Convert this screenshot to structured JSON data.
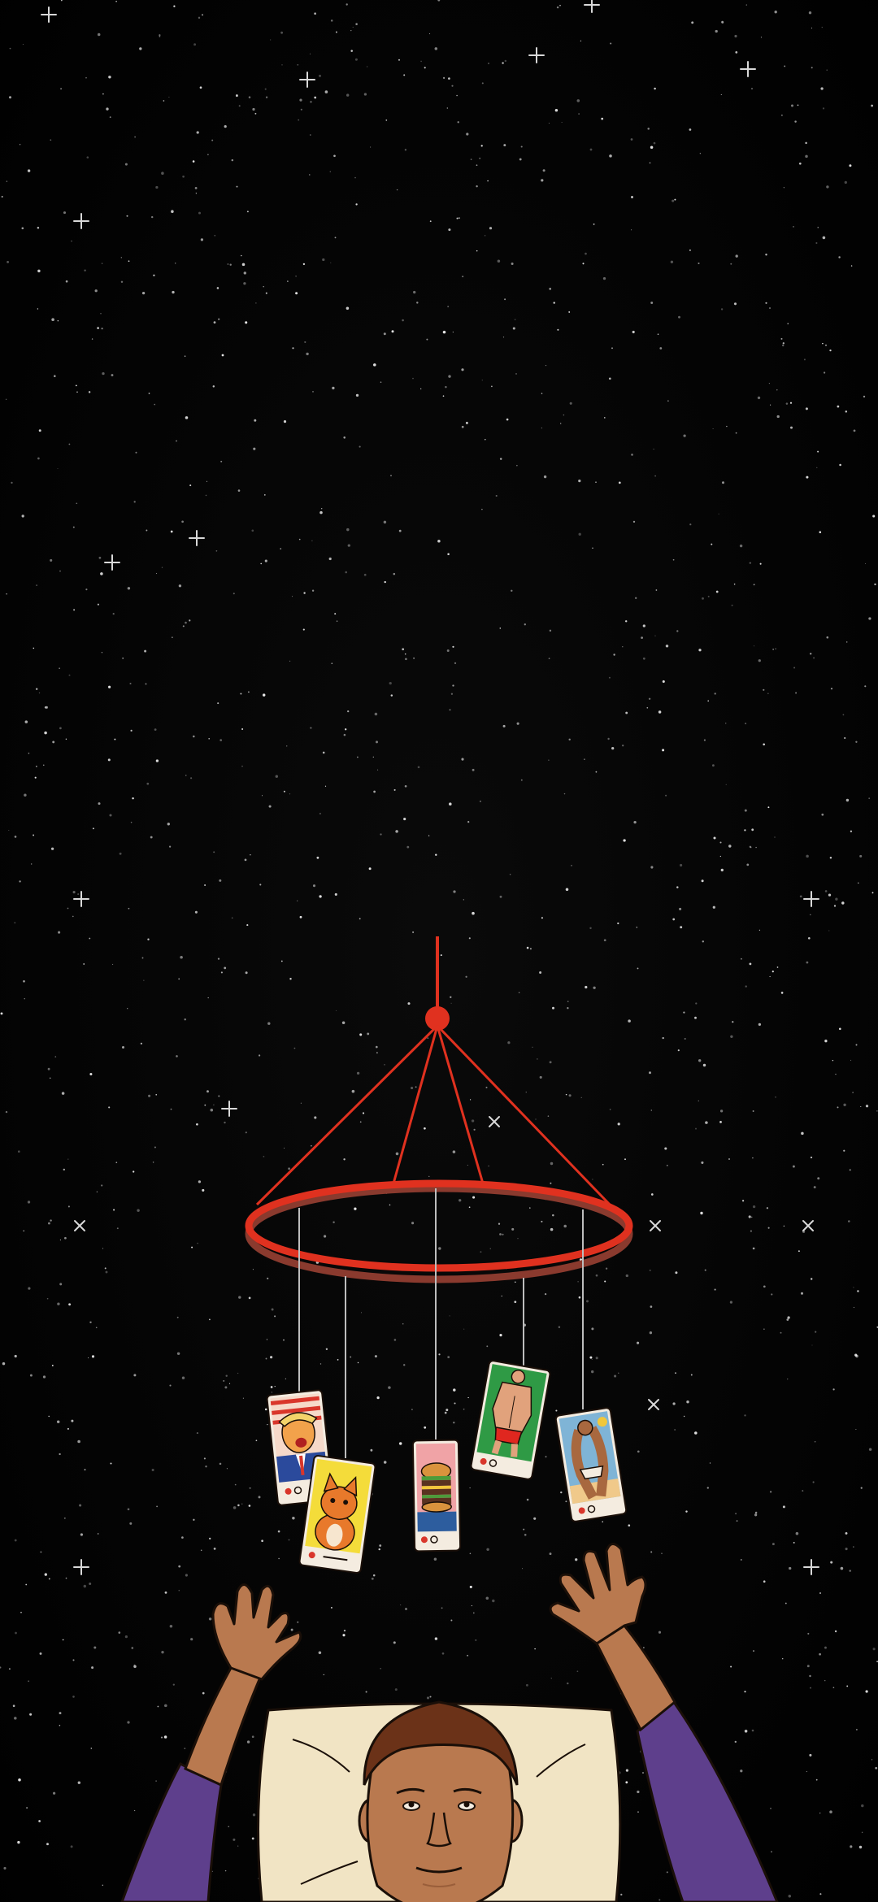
{
  "scene": {
    "background": "#050505",
    "mobile_color": "#e0311f",
    "string_color": "#bdbdbd",
    "skin": "#b9794f",
    "skin_shadow": "#9a5e3a",
    "hair": "#6b3218",
    "sleeve": "#5e3f8c",
    "pillow": "#f1e4c4",
    "outline": "#1a0f08"
  },
  "cards": [
    {
      "subject": "politician-portrait",
      "bg": "#f6d9c9"
    },
    {
      "subject": "orange-cat",
      "bg": "#f4dc3a"
    },
    {
      "subject": "burger",
      "bg": "#f0a3a6"
    },
    {
      "subject": "muscle-man",
      "bg": "#2f9a45"
    },
    {
      "subject": "beach-woman",
      "bg": "#7fb4d6"
    }
  ]
}
